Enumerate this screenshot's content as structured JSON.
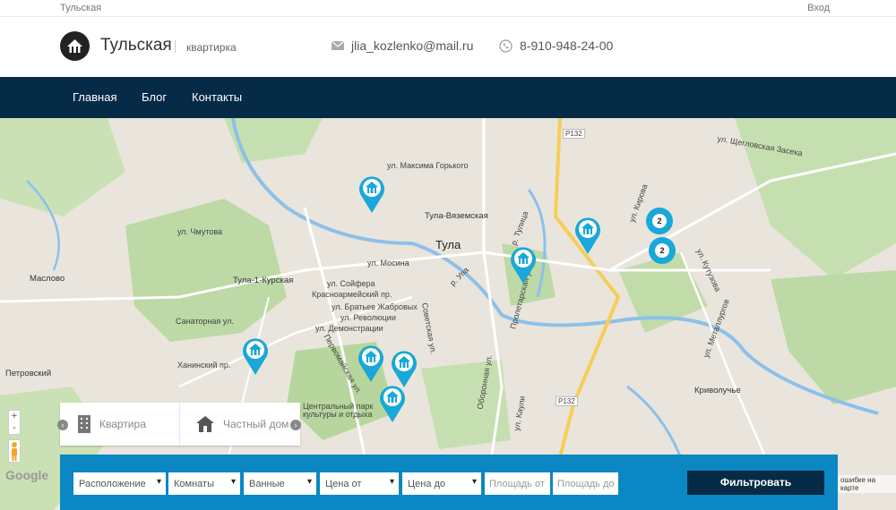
{
  "topbar": {
    "site_name": "Тульская",
    "login": "Вход"
  },
  "header": {
    "logo_title": "Тульская",
    "logo_subtitle": "квартирка",
    "email": "jlia_kozlenko@mail.ru",
    "phone": "8-910-948-24-00"
  },
  "nav": {
    "items": [
      {
        "label": "Главная"
      },
      {
        "label": "Блог"
      },
      {
        "label": "Контакты"
      }
    ]
  },
  "map": {
    "city": "Тула",
    "labels": {
      "gorky": "ул. Максима Горького",
      "tula_vyaz": "Тула-Вяземская",
      "tula_kursk": "Тула-1-Курская",
      "mosina": "ул. Мосина",
      "chmutova": "ул. Чмутова",
      "maslovo": "Маслово",
      "petrovsky": "Петровский",
      "krasnoarm": "Красноармейский пр.",
      "demonstr": "ул. Демонстрации",
      "revolucii": "ул. Революции",
      "soyfera": "ул. Сойфера",
      "bratev": "ул. Братьев Жабровых",
      "sovetskaya": "Советская ул.",
      "park": "Центральный парк культуры и отдыха",
      "krivoluchye": "Криволучье",
      "r132a": "Р132",
      "r132b": "Р132",
      "tulitsa": "р. Тулица",
      "upa": "р. Упа",
      "kutuzova": "ул. Кутузова",
      "schegl": "ул. Щегловская Засека",
      "kirova": "ул. Кирова",
      "sanatornaya": "Санаторная ул.",
      "khaninsky": "Ханинский пр.",
      "pervomay": "Первомайская ул.",
      "metallurgov": "ул. Металлургов",
      "proletarskaya": "Пролетарская ул.",
      "kaulya": "ул. Каули",
      "oboronnaya": "Оборонная ул."
    },
    "clusters": [
      {
        "count": "2"
      },
      {
        "count": "2"
      }
    ],
    "map_note": "ошибке на карте",
    "google": "Google",
    "zoom_in": "+",
    "zoom_out": "-"
  },
  "type_switch": {
    "items": [
      {
        "label": "Квартира"
      },
      {
        "label": "Частный дом"
      }
    ]
  },
  "filter": {
    "location": "Расположение",
    "rooms": "Комнаты",
    "baths": "Ванные",
    "price_from": "Цена от",
    "price_to": "Цена до",
    "area_from_placeholder": "Площадь от",
    "area_to_placeholder": "Площадь до",
    "submit": "Фильтровать"
  },
  "colors": {
    "nav_bg": "#052b46",
    "accent": "#1aa7d9",
    "filter_bg": "#0b87c3"
  }
}
